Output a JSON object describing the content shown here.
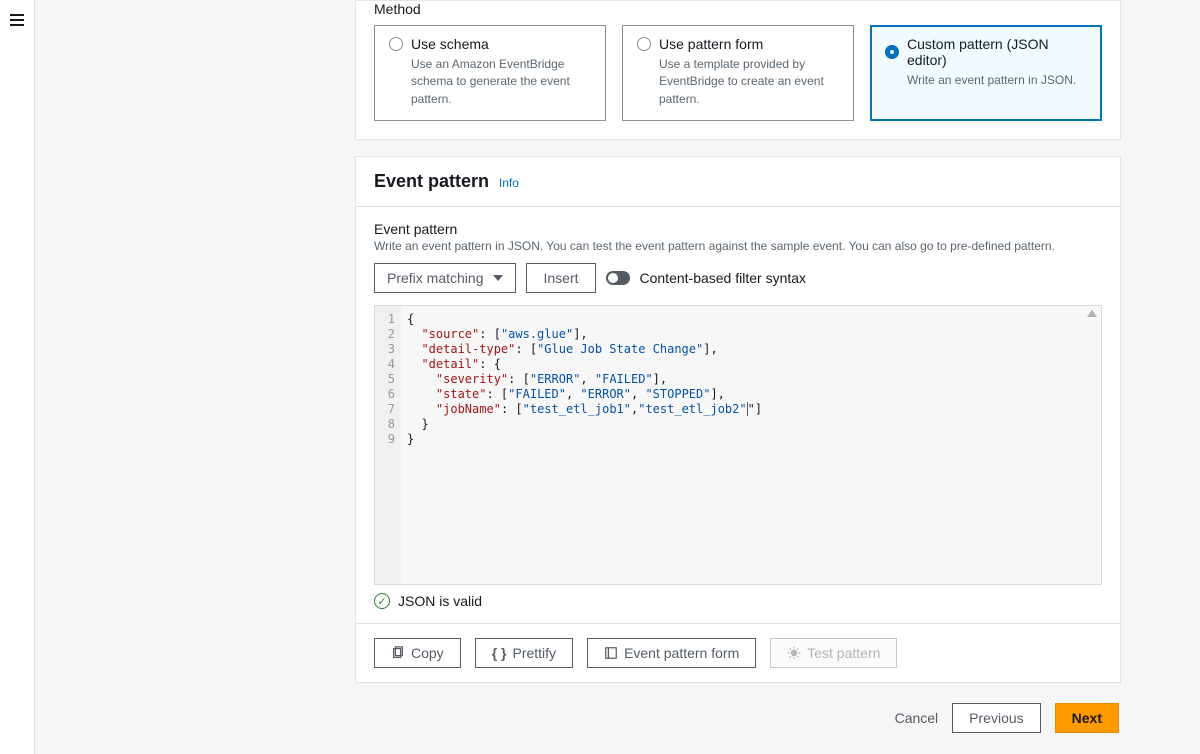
{
  "method": {
    "heading": "Method",
    "options": [
      {
        "title": "Use schema",
        "desc": "Use an Amazon EventBridge schema to generate the event pattern."
      },
      {
        "title": "Use pattern form",
        "desc": "Use a template provided by EventBridge to create an event pattern."
      },
      {
        "title": "Custom pattern (JSON editor)",
        "desc": "Write an event pattern in JSON."
      }
    ]
  },
  "pattern": {
    "title": "Event pattern",
    "info": "Info",
    "label": "Event pattern",
    "help": "Write an event pattern in JSON. You can test the event pattern against the sample event. You can also go to pre-defined pattern.",
    "match_select": "Prefix matching",
    "insert": "Insert",
    "toggle_label": "Content-based filter syntax",
    "code": {
      "lines": [
        "1",
        "2",
        "3",
        "4",
        "5",
        "6",
        "7",
        "8",
        "9"
      ],
      "source_key": "\"source\"",
      "source_val": "\"aws.glue\"",
      "dtype_key": "\"detail-type\"",
      "dtype_val": "\"Glue Job State Change\"",
      "detail_key": "\"detail\"",
      "sev_key": "\"severity\"",
      "sev_v1": "\"ERROR\"",
      "sev_v2": "\"FAILED\"",
      "state_key": "\"state\"",
      "state_v1": "\"FAILED\"",
      "state_v2": "\"ERROR\"",
      "state_v3": "\"STOPPED\"",
      "job_key": "\"jobName\"",
      "job_v1": "\"test_etl_job1\"",
      "job_v2": "\"test_etl_job2\""
    },
    "valid": "JSON is valid",
    "actions": {
      "copy": "Copy",
      "prettify": "Prettify",
      "form": "Event pattern form",
      "test": "Test pattern"
    }
  },
  "footer": {
    "cancel": "Cancel",
    "previous": "Previous",
    "next": "Next"
  }
}
